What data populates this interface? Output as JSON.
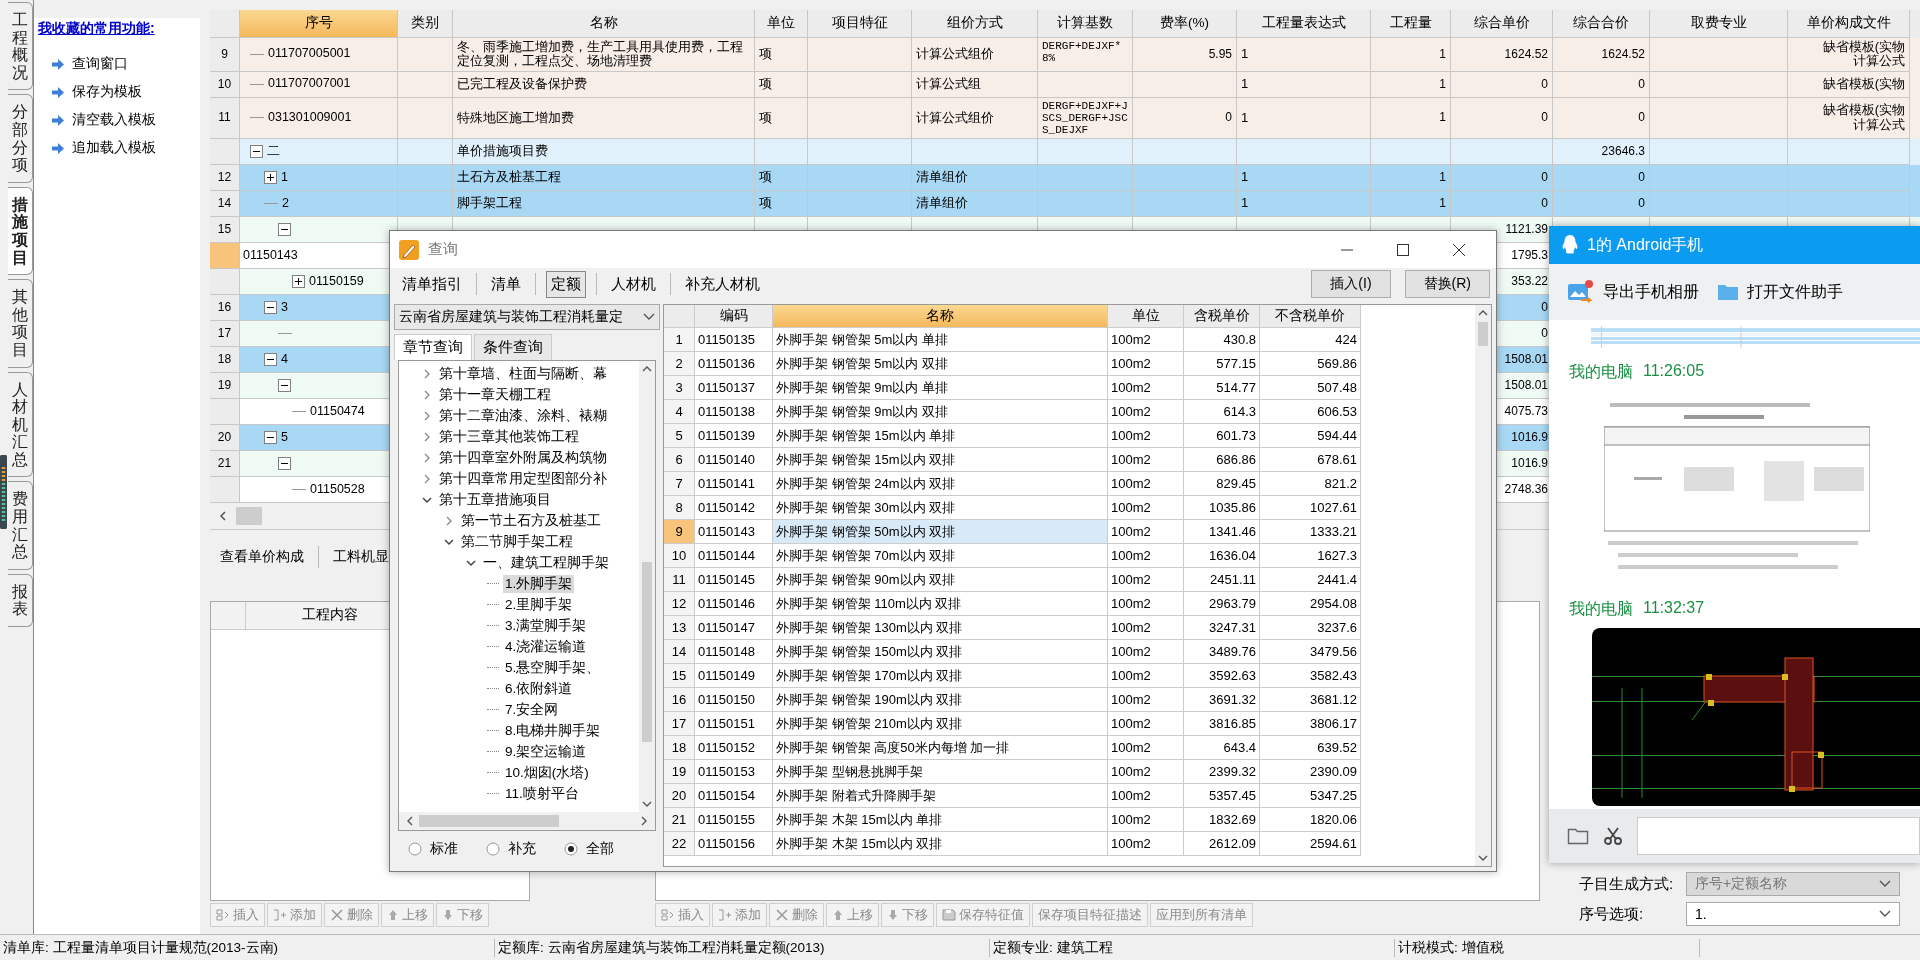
{
  "side_tabs": [
    {
      "label": "工程概况",
      "selected": false
    },
    {
      "label": "分部分项",
      "selected": false
    },
    {
      "label": "措施项目",
      "selected": true
    },
    {
      "label": "其他项目",
      "selected": false
    },
    {
      "label": "人材机汇总",
      "selected": false
    },
    {
      "label": "费用汇总",
      "selected": false
    },
    {
      "label": "报表",
      "selected": false
    }
  ],
  "favorites": {
    "title": "我收藏的常用功能:",
    "items": [
      "查询窗口",
      "保存为模板",
      "清空载入模板",
      "追加载入模板"
    ]
  },
  "grid": {
    "columns": [
      {
        "label": "序号",
        "selected": true
      },
      {
        "label": "类别",
        "selected": false
      },
      {
        "label": "名称",
        "selected": false
      },
      {
        "label": "单位",
        "selected": false
      },
      {
        "label": "项目特征",
        "selected": false
      },
      {
        "label": "组价方式",
        "selected": false
      },
      {
        "label": "计算基数",
        "selected": false
      },
      {
        "label": "费率(%)",
        "selected": false
      },
      {
        "label": "工程量表达式",
        "selected": false
      },
      {
        "label": "工程量",
        "selected": false
      },
      {
        "label": "综合单价",
        "selected": false
      },
      {
        "label": "综合合价",
        "selected": false
      },
      {
        "label": "取费专业",
        "selected": false
      },
      {
        "label": "单价构成文件",
        "selected": false
      }
    ],
    "rows": [
      {
        "num": "9",
        "code": "011707005001",
        "name": "冬、雨季施工增加费，生产工具用具使用费，工程定位复测，工程点交、场地清理费",
        "unit": "项",
        "method": "计算公式组价",
        "base": "DERGF+DEJXF*8%",
        "rate": "5.95",
        "expr": "1",
        "qty": "1",
        "price": "1624.52",
        "total": "1624.52",
        "template": [
          "缺省模板(实物",
          "计算公式"
        ],
        "kind": "item",
        "selected": false
      },
      {
        "num": "10",
        "code": "011707007001",
        "name": "已完工程及设备保护费",
        "unit": "项",
        "method": "计算公式组",
        "expr": "1",
        "qty": "1",
        "price": "0",
        "total": "0",
        "template": [
          "缺省模板(实物"
        ],
        "kind": "item",
        "selected": false
      },
      {
        "num": "11",
        "code": "031301009001",
        "name": "特殊地区施工增加费",
        "unit": "项",
        "method": "计算公式组价",
        "base": "DERGF+DEJXF+JSCS_DERGF+JSCS_DEJXF",
        "rate": "0",
        "expr": "1",
        "qty": "1",
        "price": "0",
        "total": "0",
        "template": [
          "缺省模板(实物",
          "计算公式"
        ],
        "kind": "item",
        "selected": false
      },
      {
        "code": "二",
        "expanded": true,
        "name": "单价措施项目费",
        "total": "23646.3",
        "kind": "section",
        "selected": false,
        "children": [
          {
            "num": "12",
            "code": "1",
            "expanded": false,
            "name": "土石方及桩基工程",
            "unit": "项",
            "method": "清单组价",
            "expr": "1",
            "qty": "1",
            "price": "0",
            "total": "0",
            "kind": "group",
            "selected": false
          },
          {
            "num": "14",
            "code": "2",
            "name": "脚手架工程",
            "unit": "项",
            "method": "清单组价",
            "expr": "1",
            "qty": "1",
            "price": "0",
            "total": "0",
            "kind": "group",
            "selected": false,
            "children": [
              {
                "num": "15",
                "expanded": true,
                "price": "1121.39",
                "kind": "sub",
                "selected": false,
                "children": [
                  {
                    "code": "01150143",
                    "price": "1795.3",
                    "kind": "detail",
                    "selected": true
                  },
                  {
                    "code": "01150159",
                    "expanded": false,
                    "price": "353.22",
                    "kind": "sub",
                    "selected": false
                  }
                ]
              }
            ]
          },
          {
            "num": "16",
            "code": "3",
            "expanded": true,
            "price": "0",
            "kind": "group",
            "selected": false,
            "children": [
              {
                "num": "17",
                "price": "0",
                "kind": "sub",
                "selected": false
              }
            ]
          },
          {
            "num": "18",
            "code": "4",
            "expanded": true,
            "price": "1508.01",
            "kind": "group",
            "selected": false,
            "children": [
              {
                "num": "19",
                "expanded": true,
                "price": "1508.01",
                "kind": "sub",
                "selected": false,
                "children": [
                  {
                    "code": "01150474",
                    "price": "4075.73",
                    "kind": "detail",
                    "selected": false
                  }
                ]
              }
            ]
          },
          {
            "num": "20",
            "code": "5",
            "expanded": true,
            "price": "1016.9",
            "kind": "group",
            "selected": false,
            "children": [
              {
                "num": "21",
                "expanded": true,
                "price": "1016.9",
                "kind": "sub",
                "selected": false,
                "children": [
                  {
                    "code": "01150528",
                    "price": "2748.36",
                    "kind": "detail",
                    "selected": false
                  }
                ]
              }
            ]
          }
        ]
      }
    ]
  },
  "lower_tabs": [
    {
      "label": "查看单价构成",
      "selected": false
    },
    {
      "label": "工料机显",
      "selected": false
    }
  ],
  "content_table": {
    "header": "工程内容"
  },
  "left_toolbar": [
    {
      "label": "插入",
      "kind": "insert",
      "disabled": true
    },
    {
      "label": "添加",
      "kind": "add",
      "disabled": true
    },
    {
      "label": "删除",
      "kind": "delete",
      "disabled": true
    },
    {
      "label": "上移",
      "kind": "up",
      "disabled": true
    },
    {
      "label": "下移",
      "kind": "down",
      "disabled": true
    }
  ],
  "middle_toolbar": [
    {
      "label": "插入",
      "kind": "insert",
      "disabled": true
    },
    {
      "label": "添加",
      "kind": "add",
      "disabled": true
    },
    {
      "label": "删除",
      "kind": "delete",
      "disabled": true
    },
    {
      "label": "上移",
      "kind": "up",
      "disabled": true
    },
    {
      "label": "下移",
      "kind": "down",
      "disabled": true
    },
    {
      "label": "保存特征值",
      "kind": "save",
      "disabled": true
    },
    {
      "label": "保存项目特征描述",
      "kind": "text",
      "disabled": true
    },
    {
      "label": "应用到所有清单",
      "kind": "text",
      "disabled": true
    }
  ],
  "right_options": [
    {
      "label": "子目生成方式:",
      "value": "序号+定额名称",
      "disabled": true
    },
    {
      "label": "序号选项:",
      "value": "1.",
      "disabled": false
    }
  ],
  "status_bar": [
    "清单库: 工程量清单项目计量规范(2013-云南)",
    "定额库: 云南省房屋建筑与装饰工程消耗量定额(2013)",
    "定额专业: 建筑工程",
    "计税模式: 增值税"
  ],
  "query_dialog": {
    "title": "查询",
    "tabs": [
      {
        "label": "清单指引",
        "selected": false
      },
      {
        "label": "清单",
        "selected": false
      },
      {
        "label": "定额",
        "selected": true
      },
      {
        "label": "人材机",
        "selected": false
      },
      {
        "label": "补充人材机",
        "selected": false
      }
    ],
    "buttons": [
      "插入(I)",
      "替换(R)"
    ],
    "library": "云南省房屋建筑与装饰工程消耗量定",
    "search_tabs": [
      {
        "label": "章节查询",
        "selected": true
      },
      {
        "label": "条件查询",
        "selected": false
      }
    ],
    "tree": [
      {
        "label": "第十章墙、柱面与隔断、幕",
        "expanded": false,
        "selected": false
      },
      {
        "label": "第十一章天棚工程",
        "expanded": false,
        "selected": false
      },
      {
        "label": "第十二章油漆、涂料、裱糊",
        "expanded": false,
        "selected": false
      },
      {
        "label": "第十三章其他装饰工程",
        "expanded": false,
        "selected": false
      },
      {
        "label": "第十四章室外附属及构筑物",
        "expanded": false,
        "selected": false
      },
      {
        "label": "第十四章常用定型图部分补",
        "expanded": false,
        "selected": false
      },
      {
        "label": "第十五章措施项目",
        "expanded": true,
        "selected": false,
        "children": [
          {
            "label": "第一节土石方及桩基工",
            "expanded": false,
            "selected": false
          },
          {
            "label": "第二节脚手架工程",
            "expanded": true,
            "selected": false,
            "children": [
              {
                "label": "一、建筑工程脚手架",
                "expanded": true,
                "selected": false,
                "children": [
                  {
                    "label": "1.外脚手架",
                    "selected": true
                  },
                  {
                    "label": "2.里脚手架",
                    "selected": false
                  },
                  {
                    "label": "3.满堂脚手架",
                    "selected": false
                  },
                  {
                    "label": "4.浇灌运输道",
                    "selected": false
                  },
                  {
                    "label": "5.悬空脚手架、",
                    "selected": false
                  },
                  {
                    "label": "6.依附斜道",
                    "selected": false
                  },
                  {
                    "label": "7.安全网",
                    "selected": false
                  },
                  {
                    "label": "8.电梯井脚手架",
                    "selected": false
                  },
                  {
                    "label": "9.架空运输道",
                    "selected": false
                  },
                  {
                    "label": "10.烟囱(水塔)",
                    "selected": false
                  },
                  {
                    "label": "11.喷射平台",
                    "selected": false
                  }
                ]
              }
            ]
          }
        ]
      }
    ],
    "filters": [
      {
        "label": "标准",
        "selected": false
      },
      {
        "label": "补充",
        "selected": false
      },
      {
        "label": "全部",
        "selected": true
      }
    ],
    "columns": [
      {
        "label": "编码",
        "selected": false
      },
      {
        "label": "名称",
        "selected": true
      },
      {
        "label": "单位",
        "selected": false
      },
      {
        "label": "含税单价",
        "selected": false
      },
      {
        "label": "不含税单价",
        "selected": false
      }
    ],
    "rows": [
      {
        "num": "1",
        "code": "01150135",
        "name": "外脚手架 钢管架 5m以内 单排",
        "unit": "100m2",
        "tax_price": "430.8",
        "price": "424",
        "selected": false
      },
      {
        "num": "2",
        "code": "01150136",
        "name": "外脚手架 钢管架 5m以内 双排",
        "unit": "100m2",
        "tax_price": "577.15",
        "price": "569.86",
        "selected": false
      },
      {
        "num": "3",
        "code": "01150137",
        "name": "外脚手架 钢管架 9m以内 单排",
        "unit": "100m2",
        "tax_price": "514.77",
        "price": "507.48",
        "selected": false
      },
      {
        "num": "4",
        "code": "01150138",
        "name": "外脚手架 钢管架 9m以内 双排",
        "unit": "100m2",
        "tax_price": "614.3",
        "price": "606.53",
        "selected": false
      },
      {
        "num": "5",
        "code": "01150139",
        "name": "外脚手架 钢管架 15m以内 单排",
        "unit": "100m2",
        "tax_price": "601.73",
        "price": "594.44",
        "selected": false
      },
      {
        "num": "6",
        "code": "01150140",
        "name": "外脚手架 钢管架 15m以内 双排",
        "unit": "100m2",
        "tax_price": "686.86",
        "price": "678.61",
        "selected": false
      },
      {
        "num": "7",
        "code": "01150141",
        "name": "外脚手架 钢管架 24m以内 双排",
        "unit": "100m2",
        "tax_price": "829.45",
        "price": "821.2",
        "selected": false
      },
      {
        "num": "8",
        "code": "01150142",
        "name": "外脚手架 钢管架 30m以内 双排",
        "unit": "100m2",
        "tax_price": "1035.86",
        "price": "1027.61",
        "selected": false
      },
      {
        "num": "9",
        "code": "01150143",
        "name": "外脚手架 钢管架 50m以内 双排",
        "unit": "100m2",
        "tax_price": "1341.46",
        "price": "1333.21",
        "selected": true
      },
      {
        "num": "10",
        "code": "01150144",
        "name": "外脚手架 钢管架 70m以内 双排",
        "unit": "100m2",
        "tax_price": "1636.04",
        "price": "1627.3",
        "selected": false
      },
      {
        "num": "11",
        "code": "01150145",
        "name": "外脚手架 钢管架 90m以内 双排",
        "unit": "100m2",
        "tax_price": "2451.11",
        "price": "2441.4",
        "selected": false
      },
      {
        "num": "12",
        "code": "01150146",
        "name": "外脚手架 钢管架 110m以内 双排",
        "unit": "100m2",
        "tax_price": "2963.79",
        "price": "2954.08",
        "selected": false
      },
      {
        "num": "13",
        "code": "01150147",
        "name": "外脚手架 钢管架 130m以内 双排",
        "unit": "100m2",
        "tax_price": "3247.31",
        "price": "3237.6",
        "selected": false
      },
      {
        "num": "14",
        "code": "01150148",
        "name": "外脚手架 钢管架 150m以内 双排",
        "unit": "100m2",
        "tax_price": "3489.76",
        "price": "3479.56",
        "selected": false
      },
      {
        "num": "15",
        "code": "01150149",
        "name": "外脚手架 钢管架 170m以内 双排",
        "unit": "100m2",
        "tax_price": "3592.63",
        "price": "3582.43",
        "selected": false
      },
      {
        "num": "16",
        "code": "01150150",
        "name": "外脚手架 钢管架 190m以内 双排",
        "unit": "100m2",
        "tax_price": "3691.32",
        "price": "3681.12",
        "selected": false
      },
      {
        "num": "17",
        "code": "01150151",
        "name": "外脚手架 钢管架 210m以内 双排",
        "unit": "100m2",
        "tax_price": "3816.85",
        "price": "3806.17",
        "selected": false
      },
      {
        "num": "18",
        "code": "01150152",
        "name": "外脚手架 钢管架 高度50米内每增 加一排",
        "unit": "100m2",
        "tax_price": "643.4",
        "price": "639.52",
        "selected": false
      },
      {
        "num": "19",
        "code": "01150153",
        "name": "外脚手架 型钢悬挑脚手架",
        "unit": "100m2",
        "tax_price": "2399.32",
        "price": "2390.09",
        "selected": false
      },
      {
        "num": "20",
        "code": "01150154",
        "name": "外脚手架 附着式升降脚手架",
        "unit": "100m2",
        "tax_price": "5357.45",
        "price": "5347.25",
        "selected": false
      },
      {
        "num": "21",
        "code": "01150155",
        "name": "外脚手架 木架 15m以内 单排",
        "unit": "100m2",
        "tax_price": "1832.69",
        "price": "1820.06",
        "selected": false
      },
      {
        "num": "22",
        "code": "01150156",
        "name": "外脚手架 木架 15m以内 双排",
        "unit": "100m2",
        "tax_price": "2612.09",
        "price": "2594.61",
        "selected": false
      }
    ]
  },
  "phone_window": {
    "title": "1的 Android手机",
    "actions": [
      {
        "label": "导出手机相册",
        "kind": "album"
      },
      {
        "label": "打开文件助手",
        "kind": "folder"
      }
    ],
    "messages": [
      {
        "kind": "picture"
      },
      {
        "kind": "header",
        "sender": "我的电脑",
        "time": "11:26:05"
      },
      {
        "kind": "picture"
      },
      {
        "kind": "header",
        "sender": "我的电脑",
        "time": "11:32:37"
      },
      {
        "kind": "picture"
      }
    ]
  }
}
